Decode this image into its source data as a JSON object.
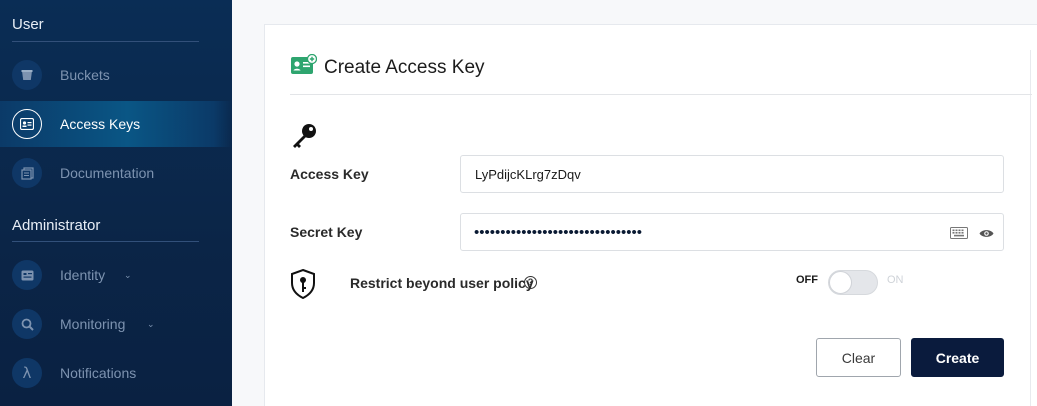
{
  "sidebar": {
    "user_section": "User",
    "admin_section": "Administrator",
    "items": [
      {
        "label": "Buckets",
        "icon": "bucket-icon"
      },
      {
        "label": "Access Keys",
        "icon": "access-key-card-icon",
        "active": true
      },
      {
        "label": "Documentation",
        "icon": "documentation-icon"
      },
      {
        "label": "Identity",
        "icon": "identity-icon",
        "expandable": true
      },
      {
        "label": "Monitoring",
        "icon": "monitoring-icon",
        "expandable": true
      },
      {
        "label": "Notifications",
        "icon": "lambda-icon"
      }
    ]
  },
  "page": {
    "title": "Create Access Key",
    "title_icon": "access-key-card-icon"
  },
  "form": {
    "key_icon": "key-icon",
    "access_key_label": "Access Key",
    "access_key_value": "LyPdijcKLrg7zDqv",
    "secret_key_label": "Secret Key",
    "secret_key_masked": "••••••••••••••••••••••••••••••••",
    "restrict_label": "Restrict beyond user policy",
    "toggle_off_label": "OFF",
    "toggle_on_label": "ON",
    "toggle_state": "off"
  },
  "actions": {
    "clear_label": "Clear",
    "create_label": "Create"
  },
  "colors": {
    "sidebar_bg": "#0b2547",
    "primary_button": "#0a1b3d",
    "title_icon": "#2ea56f"
  }
}
